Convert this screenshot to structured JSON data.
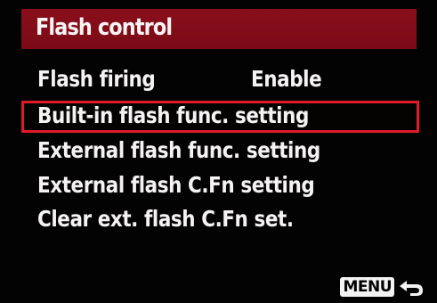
{
  "header": {
    "title": "Flash control"
  },
  "menu": {
    "items": [
      {
        "label": "Flash firing",
        "value": "Enable"
      },
      {
        "label": "Built-in flash func. setting"
      },
      {
        "label": "External flash func. setting"
      },
      {
        "label": "External flash C.Fn setting"
      },
      {
        "label": "Clear ext. flash C.Fn set."
      }
    ],
    "selected_index": 1
  },
  "footer": {
    "menu_label": "MENU",
    "back_icon": "return-arrow-icon"
  },
  "colors": {
    "title_bar": "#7f0c18",
    "selection_border": "#e01a28",
    "background": "#040303",
    "text": "#f4f2f2"
  }
}
